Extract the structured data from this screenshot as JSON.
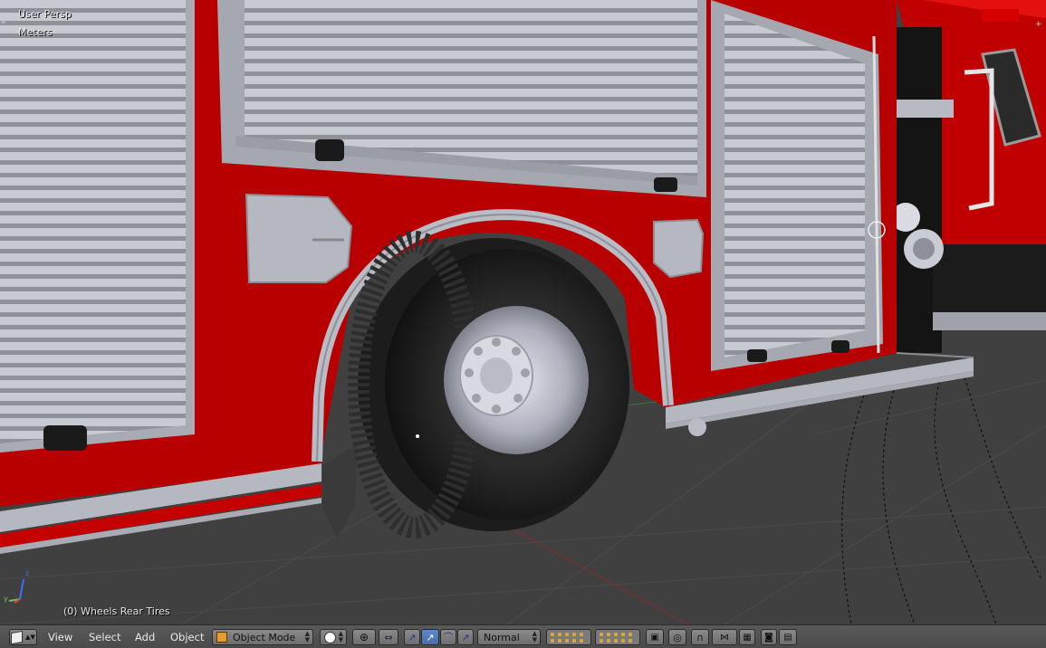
{
  "viewport": {
    "view_name": "User Persp",
    "units": "Meters",
    "selection_info": "(0) Wheels Rear Tires"
  },
  "header": {
    "editor_type_icon": "cube-icon",
    "menus": [
      "View",
      "Select",
      "Add",
      "Object"
    ],
    "mode": "Object Mode",
    "pivot_icon": "pivot-icon",
    "transform_orientation": "Normal"
  },
  "colors": {
    "truck_red": "#b80000",
    "panel_gray": "#b9bcc4",
    "tire": "#1f1f1f",
    "ground": "#3f3f3f",
    "header_bg": "#4e4e4e"
  }
}
